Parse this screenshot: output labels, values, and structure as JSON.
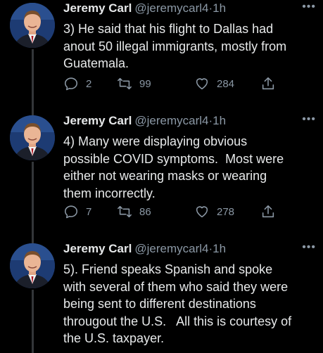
{
  "tweets": [
    {
      "author_name": "Jeremy Carl",
      "handle": "@jeremycarl4",
      "separator": "·",
      "time": "1h",
      "text": "3) He said that his flight to Dallas had\nanout 50 illegal immigrants, mostly from\nGuatemala.",
      "replies": "2",
      "retweets": "99",
      "likes": "284"
    },
    {
      "author_name": "Jeremy Carl",
      "handle": "@jeremycarl4",
      "separator": "·",
      "time": "1h",
      "text": "4) Many were displaying obvious\npossible COVID symptoms.  Most were\neither not wearing masks or wearing\nthem incorrectly.",
      "replies": "7",
      "retweets": "86",
      "likes": "278"
    },
    {
      "author_name": "Jeremy Carl",
      "handle": "@jeremycarl4",
      "separator": "·",
      "time": "1h",
      "text": "5). Friend speaks Spanish and spoke\nwith several of them who said they were\nbeing sent to different destinations\nthrougout the U.S.   All this is courtesy of\nthe U.S. taxpayer.",
      "replies": "",
      "retweets": "",
      "likes": ""
    }
  ],
  "more_icon": "more-horizontal-icon",
  "colors": {
    "background": "#000000",
    "text": "#e7e9ea",
    "secondary": "#8b98a5",
    "thread_line": "#333639"
  }
}
